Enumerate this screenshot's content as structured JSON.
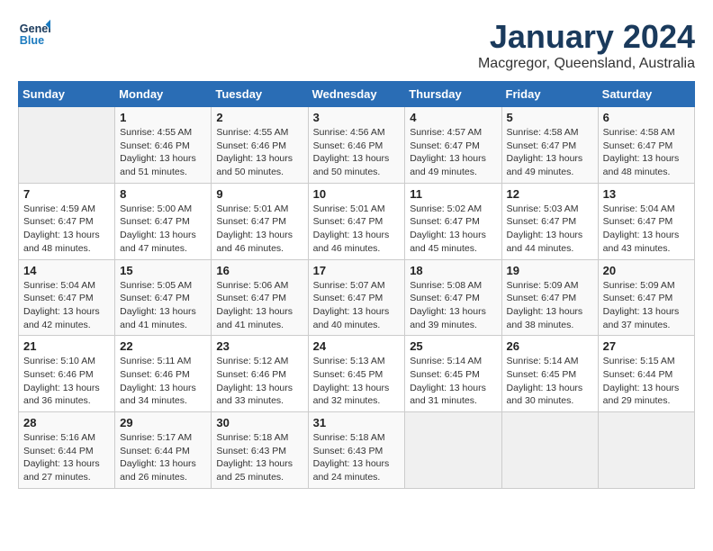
{
  "header": {
    "logo_line1": "General",
    "logo_line2": "Blue",
    "month": "January 2024",
    "location": "Macgregor, Queensland, Australia"
  },
  "weekdays": [
    "Sunday",
    "Monday",
    "Tuesday",
    "Wednesday",
    "Thursday",
    "Friday",
    "Saturday"
  ],
  "weeks": [
    [
      {
        "day": "",
        "empty": true
      },
      {
        "day": "1",
        "sunrise": "4:55 AM",
        "sunset": "6:46 PM",
        "daylight": "13 hours and 51 minutes."
      },
      {
        "day": "2",
        "sunrise": "4:55 AM",
        "sunset": "6:46 PM",
        "daylight": "13 hours and 50 minutes."
      },
      {
        "day": "3",
        "sunrise": "4:56 AM",
        "sunset": "6:46 PM",
        "daylight": "13 hours and 50 minutes."
      },
      {
        "day": "4",
        "sunrise": "4:57 AM",
        "sunset": "6:47 PM",
        "daylight": "13 hours and 49 minutes."
      },
      {
        "day": "5",
        "sunrise": "4:58 AM",
        "sunset": "6:47 PM",
        "daylight": "13 hours and 49 minutes."
      },
      {
        "day": "6",
        "sunrise": "4:58 AM",
        "sunset": "6:47 PM",
        "daylight": "13 hours and 48 minutes."
      }
    ],
    [
      {
        "day": "7",
        "sunrise": "4:59 AM",
        "sunset": "6:47 PM",
        "daylight": "13 hours and 48 minutes."
      },
      {
        "day": "8",
        "sunrise": "5:00 AM",
        "sunset": "6:47 PM",
        "daylight": "13 hours and 47 minutes."
      },
      {
        "day": "9",
        "sunrise": "5:01 AM",
        "sunset": "6:47 PM",
        "daylight": "13 hours and 46 minutes."
      },
      {
        "day": "10",
        "sunrise": "5:01 AM",
        "sunset": "6:47 PM",
        "daylight": "13 hours and 46 minutes."
      },
      {
        "day": "11",
        "sunrise": "5:02 AM",
        "sunset": "6:47 PM",
        "daylight": "13 hours and 45 minutes."
      },
      {
        "day": "12",
        "sunrise": "5:03 AM",
        "sunset": "6:47 PM",
        "daylight": "13 hours and 44 minutes."
      },
      {
        "day": "13",
        "sunrise": "5:04 AM",
        "sunset": "6:47 PM",
        "daylight": "13 hours and 43 minutes."
      }
    ],
    [
      {
        "day": "14",
        "sunrise": "5:04 AM",
        "sunset": "6:47 PM",
        "daylight": "13 hours and 42 minutes."
      },
      {
        "day": "15",
        "sunrise": "5:05 AM",
        "sunset": "6:47 PM",
        "daylight": "13 hours and 41 minutes."
      },
      {
        "day": "16",
        "sunrise": "5:06 AM",
        "sunset": "6:47 PM",
        "daylight": "13 hours and 41 minutes."
      },
      {
        "day": "17",
        "sunrise": "5:07 AM",
        "sunset": "6:47 PM",
        "daylight": "13 hours and 40 minutes."
      },
      {
        "day": "18",
        "sunrise": "5:08 AM",
        "sunset": "6:47 PM",
        "daylight": "13 hours and 39 minutes."
      },
      {
        "day": "19",
        "sunrise": "5:09 AM",
        "sunset": "6:47 PM",
        "daylight": "13 hours and 38 minutes."
      },
      {
        "day": "20",
        "sunrise": "5:09 AM",
        "sunset": "6:47 PM",
        "daylight": "13 hours and 37 minutes."
      }
    ],
    [
      {
        "day": "21",
        "sunrise": "5:10 AM",
        "sunset": "6:46 PM",
        "daylight": "13 hours and 36 minutes."
      },
      {
        "day": "22",
        "sunrise": "5:11 AM",
        "sunset": "6:46 PM",
        "daylight": "13 hours and 34 minutes."
      },
      {
        "day": "23",
        "sunrise": "5:12 AM",
        "sunset": "6:46 PM",
        "daylight": "13 hours and 33 minutes."
      },
      {
        "day": "24",
        "sunrise": "5:13 AM",
        "sunset": "6:45 PM",
        "daylight": "13 hours and 32 minutes."
      },
      {
        "day": "25",
        "sunrise": "5:14 AM",
        "sunset": "6:45 PM",
        "daylight": "13 hours and 31 minutes."
      },
      {
        "day": "26",
        "sunrise": "5:14 AM",
        "sunset": "6:45 PM",
        "daylight": "13 hours and 30 minutes."
      },
      {
        "day": "27",
        "sunrise": "5:15 AM",
        "sunset": "6:44 PM",
        "daylight": "13 hours and 29 minutes."
      }
    ],
    [
      {
        "day": "28",
        "sunrise": "5:16 AM",
        "sunset": "6:44 PM",
        "daylight": "13 hours and 27 minutes."
      },
      {
        "day": "29",
        "sunrise": "5:17 AM",
        "sunset": "6:44 PM",
        "daylight": "13 hours and 26 minutes."
      },
      {
        "day": "30",
        "sunrise": "5:18 AM",
        "sunset": "6:43 PM",
        "daylight": "13 hours and 25 minutes."
      },
      {
        "day": "31",
        "sunrise": "5:18 AM",
        "sunset": "6:43 PM",
        "daylight": "13 hours and 24 minutes."
      },
      {
        "day": "",
        "empty": true
      },
      {
        "day": "",
        "empty": true
      },
      {
        "day": "",
        "empty": true
      }
    ]
  ]
}
